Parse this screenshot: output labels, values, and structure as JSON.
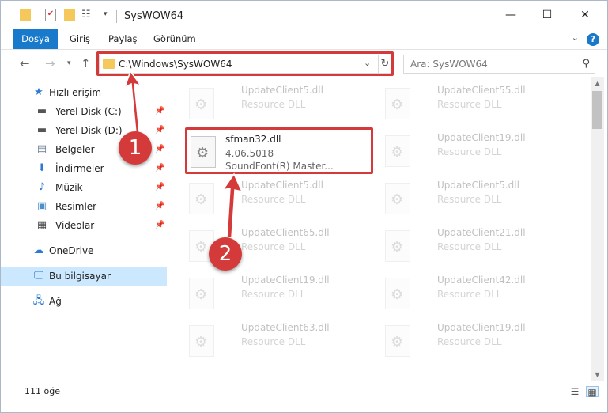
{
  "window": {
    "title": "SysWOW64",
    "controls": {
      "minimize": "—",
      "maximize": "☐",
      "close": "✕"
    }
  },
  "ribbon": {
    "tabs": [
      "Dosya",
      "Giriş",
      "Paylaş",
      "Görünüm"
    ],
    "help": "?"
  },
  "address": {
    "path": "C:\\Windows\\SysWOW64",
    "search_placeholder": "Ara: SysWOW64"
  },
  "nav": {
    "quick_access": "Hızlı erişim",
    "items": [
      {
        "label": "Yerel Disk (C:)",
        "icon": "drive-icon"
      },
      {
        "label": "Yerel Disk (D:)",
        "icon": "drive-icon"
      },
      {
        "label": "Belgeler",
        "icon": "documents-icon"
      },
      {
        "label": "İndirmeler",
        "icon": "downloads-icon"
      },
      {
        "label": "Müzik",
        "icon": "music-icon"
      },
      {
        "label": "Resimler",
        "icon": "pictures-icon"
      },
      {
        "label": "Videolar",
        "icon": "videos-icon"
      }
    ],
    "onedrive": "OneDrive",
    "this_pc": "Bu bilgisayar",
    "network": "Ağ"
  },
  "files": {
    "left": [
      {
        "name": "UpdateClient5.dll",
        "type": "Resource DLL"
      },
      {
        "name": "sfman32.dll",
        "version": "4.06.5018",
        "type": "SoundFont(R) Master..."
      },
      {
        "name": "UpdateClient5.dll",
        "type": "Resource DLL"
      },
      {
        "name": "UpdateClient65.dll",
        "type": "Resource DLL"
      },
      {
        "name": "UpdateClient19.dll",
        "type": "Resource DLL"
      },
      {
        "name": "UpdateClient63.dll",
        "type": "Resource DLL"
      }
    ],
    "right": [
      {
        "name": "UpdateClient55.dll",
        "type": "Resource DLL"
      },
      {
        "name": "UpdateClient19.dll",
        "type": "Resource DLL"
      },
      {
        "name": "UpdateClient5.dll",
        "type": "Resource DLL"
      },
      {
        "name": "UpdateClient21.dll",
        "type": "Resource DLL"
      },
      {
        "name": "UpdateClient42.dll",
        "type": "Resource DLL"
      },
      {
        "name": "UpdateClient19.dll",
        "type": "Resource DLL"
      }
    ]
  },
  "status": {
    "count": "111 öğe"
  },
  "annotations": {
    "step1": "1",
    "step2": "2",
    "color": "#d43a3a"
  }
}
